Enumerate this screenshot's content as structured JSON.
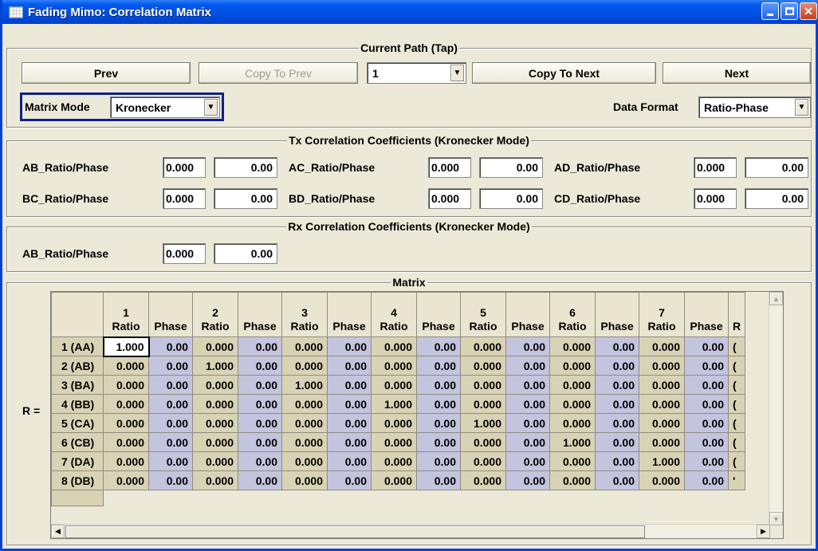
{
  "window": {
    "title": "Fading Mimo: Correlation Matrix"
  },
  "current_path": {
    "legend": "Current Path (Tap)",
    "prev": "Prev",
    "copy_to_prev": "Copy To Prev",
    "tap_value": "1",
    "copy_to_next": "Copy To Next",
    "next": "Next"
  },
  "matrix_mode": {
    "label": "Matrix Mode",
    "value": "Kronecker"
  },
  "data_format": {
    "label": "Data Format",
    "value": "Ratio-Phase"
  },
  "tx": {
    "legend": "Tx Correlation Coefficients (Kronecker Mode)",
    "items": [
      {
        "label": "AB_Ratio/Phase",
        "ratio": "0.000",
        "phase": "0.00"
      },
      {
        "label": "AC_Ratio/Phase",
        "ratio": "0.000",
        "phase": "0.00"
      },
      {
        "label": "AD_Ratio/Phase",
        "ratio": "0.000",
        "phase": "0.00"
      },
      {
        "label": "BC_Ratio/Phase",
        "ratio": "0.000",
        "phase": "0.00"
      },
      {
        "label": "BD_Ratio/Phase",
        "ratio": "0.000",
        "phase": "0.00"
      },
      {
        "label": "CD_Ratio/Phase",
        "ratio": "0.000",
        "phase": "0.00"
      }
    ]
  },
  "rx": {
    "legend": "Rx Correlation Coefficients (Kronecker Mode)",
    "items": [
      {
        "label": "AB_Ratio/Phase",
        "ratio": "0.000",
        "phase": "0.00"
      }
    ]
  },
  "matrix": {
    "legend": "Matrix",
    "r_label": "R =",
    "columns": [
      {
        "num": "1",
        "ratio": "Ratio",
        "phase": "Phase"
      },
      {
        "num": "2",
        "ratio": "Ratio",
        "phase": "Phase"
      },
      {
        "num": "3",
        "ratio": "Ratio",
        "phase": "Phase"
      },
      {
        "num": "4",
        "ratio": "Ratio",
        "phase": "Phase"
      },
      {
        "num": "5",
        "ratio": "Ratio",
        "phase": "Phase"
      },
      {
        "num": "6",
        "ratio": "Ratio",
        "phase": "Phase"
      },
      {
        "num": "7",
        "ratio": "Ratio",
        "phase": "Phase"
      }
    ],
    "partial_header": "R",
    "rows": [
      {
        "label": "1 (AA)",
        "cells": [
          "1.000",
          "0.00",
          "0.000",
          "0.00",
          "0.000",
          "0.00",
          "0.000",
          "0.00",
          "0.000",
          "0.00",
          "0.000",
          "0.00",
          "0.000",
          "0.00"
        ],
        "partial": "("
      },
      {
        "label": "2 (AB)",
        "cells": [
          "0.000",
          "0.00",
          "1.000",
          "0.00",
          "0.000",
          "0.00",
          "0.000",
          "0.00",
          "0.000",
          "0.00",
          "0.000",
          "0.00",
          "0.000",
          "0.00"
        ],
        "partial": "("
      },
      {
        "label": "3 (BA)",
        "cells": [
          "0.000",
          "0.00",
          "0.000",
          "0.00",
          "1.000",
          "0.00",
          "0.000",
          "0.00",
          "0.000",
          "0.00",
          "0.000",
          "0.00",
          "0.000",
          "0.00"
        ],
        "partial": "("
      },
      {
        "label": "4 (BB)",
        "cells": [
          "0.000",
          "0.00",
          "0.000",
          "0.00",
          "0.000",
          "0.00",
          "1.000",
          "0.00",
          "0.000",
          "0.00",
          "0.000",
          "0.00",
          "0.000",
          "0.00"
        ],
        "partial": "("
      },
      {
        "label": "5 (CA)",
        "cells": [
          "0.000",
          "0.00",
          "0.000",
          "0.00",
          "0.000",
          "0.00",
          "0.000",
          "0.00",
          "1.000",
          "0.00",
          "0.000",
          "0.00",
          "0.000",
          "0.00"
        ],
        "partial": "("
      },
      {
        "label": "6 (CB)",
        "cells": [
          "0.000",
          "0.00",
          "0.000",
          "0.00",
          "0.000",
          "0.00",
          "0.000",
          "0.00",
          "0.000",
          "0.00",
          "1.000",
          "0.00",
          "0.000",
          "0.00"
        ],
        "partial": "("
      },
      {
        "label": "7 (DA)",
        "cells": [
          "0.000",
          "0.00",
          "0.000",
          "0.00",
          "0.000",
          "0.00",
          "0.000",
          "0.00",
          "0.000",
          "0.00",
          "0.000",
          "0.00",
          "1.000",
          "0.00"
        ],
        "partial": "("
      },
      {
        "label": "8 (DB)",
        "cells": [
          "0.000",
          "0.00",
          "0.000",
          "0.00",
          "0.000",
          "0.00",
          "0.000",
          "0.00",
          "0.000",
          "0.00",
          "0.000",
          "0.00",
          "0.000",
          "0.00"
        ],
        "partial": "'"
      }
    ]
  },
  "icons": {
    "app": "app-icon",
    "minimize": "minimize-icon",
    "maximize": "maximize-icon",
    "close": "close-icon",
    "dropdown": "chevron-down-icon",
    "scroll_up": "scroll-up-icon",
    "scroll_down": "scroll-down-icon",
    "scroll_left": "scroll-left-icon",
    "scroll_right": "scroll-right-icon"
  }
}
